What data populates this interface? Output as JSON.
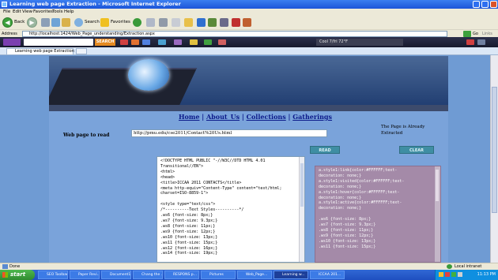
{
  "window": {
    "title": "Learning web page Extraction - Microsoft Internet Explorer"
  },
  "menu": [
    "File",
    "Edit",
    "View",
    "Favorites",
    "Tools",
    "Help"
  ],
  "toolbar": {
    "back_label": "Back",
    "search_label": "Search",
    "favorites_label": "Favorites"
  },
  "address": {
    "label": "Address",
    "url": "http://localhost:1424/Web_Page_understanding/Extraction.aspx",
    "go_label": "Go",
    "links_label": "Links"
  },
  "dark_toolbar": {
    "search_button": "SEARCH",
    "weather": "Cool 7/fri 72°F"
  },
  "tab": {
    "label": "Learning web page Extraction"
  },
  "page": {
    "nav": [
      "Home",
      "About_Us",
      "Collections",
      "Gatherings"
    ],
    "read_label": "Web page to read",
    "url_value": "http://pmu.edu/cse2011/Contact%20Us.html",
    "status_note": "The Page is Already Extracted",
    "read_button": "READ",
    "clear_button": "CLEAR",
    "source_text": "<!DOCTYPE HTML PUBLIC \"-//W3C//DTD HTML 4.01\nTransitional//EN\">\n<html>\n<head>\n<title>ICCAA 2011 CONTACTS</title>\n<meta http-equiv=\"Content-Type\" content=\"text/html;\ncharset=ISO-8859-1\">\n\n<style type=\"text/css\">\n/*----------Text Styles----------*/\n.ws6 {font-size: 8px;}\n.ws7 {font-size: 9.3px;}\n.ws8 {font-size: 11px;}\n.ws9 {font-size: 12px;}\n.ws10 {font-size: 13px;}\n.ws11 {font-size: 15px;}\n.ws12 {font-size: 16px;}\n.ws14 {font-size: 19px;}",
    "css_text": "a.style1:link{color:#FFFFFF;text-\ndecoration: none;}\na.style1:visited{color:#FFFFFF;text-\ndecoration: none;}\na.style1:hover{color:#FFFFFF;text-\ndecoration: none;}\na.style1:active{color:#FFFFFF;text-\ndecoration: none;}\n\n.ws6 {font-size: 8px;}\n.ws7 {font-size: 9.3px;}\n.ws8 {font-size: 11px;}\n.ws9 {font-size: 12px;}\n.ws10 {font-size: 13px;}\n.ws11 {font-size: 15px;}"
  },
  "status": {
    "left": "Done",
    "zone": "Local intranet"
  },
  "taskbar": {
    "start": "start",
    "tasks": [
      "SEO Toolbar",
      "Paper Revi...",
      "Document1 ...",
      "Chang the ...",
      "RESPONS p...",
      "Pictures",
      "Web_Page...",
      "Learning w...",
      "ICCAA 201..."
    ],
    "clock": "11:13 PM"
  },
  "colors": {
    "page_background": "#6f9bd3",
    "nav_link": "#0c1a8a",
    "button": "#3f8ea3",
    "css_panel": "#a48aa8"
  }
}
